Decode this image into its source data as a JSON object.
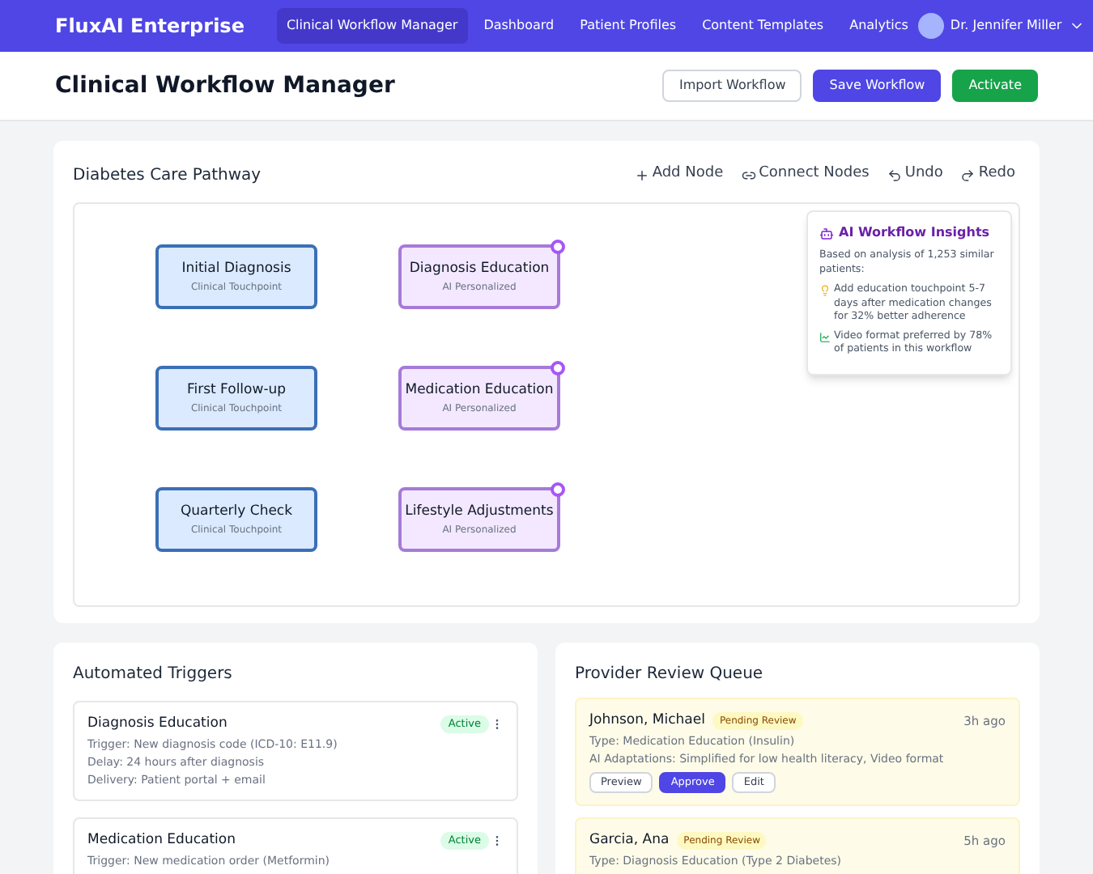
{
  "nav": {
    "brand": "FluxAI Enterprise",
    "links": [
      {
        "label": "Clinical Workflow Manager",
        "selected": true
      },
      {
        "label": "Dashboard",
        "selected": false
      },
      {
        "label": "Patient Profiles",
        "selected": false
      },
      {
        "label": "Content Templates",
        "selected": false
      },
      {
        "label": "Analytics",
        "selected": false
      }
    ],
    "user": "Dr. Jennifer Miller"
  },
  "header": {
    "title": "Clinical Workflow Manager",
    "buttons": [
      {
        "label": "Import Workflow",
        "kind": "outline"
      },
      {
        "label": "Save Workflow",
        "kind": "primary"
      },
      {
        "label": "Activate",
        "kind": "success"
      }
    ]
  },
  "pathway": {
    "title": "Diabetes Care Pathway",
    "tools": [
      {
        "label": "Add Node",
        "kind": "add"
      },
      {
        "label": "Connect Nodes",
        "kind": "link"
      },
      {
        "label": "Undo",
        "kind": "undo"
      },
      {
        "label": "Redo",
        "kind": "redo"
      }
    ],
    "nodes": [
      {
        "title": "Initial Diagnosis",
        "subtitle": "Clinical Touchpoint",
        "kind": "clinical"
      },
      {
        "title": "Diagnosis Education",
        "subtitle": "AI Personalized",
        "kind": "ai"
      },
      {
        "title": "First Follow-up",
        "subtitle": "Clinical Touchpoint",
        "kind": "clinical"
      },
      {
        "title": "Medication Education",
        "subtitle": "AI Personalized",
        "kind": "ai"
      },
      {
        "title": "Quarterly Check",
        "subtitle": "Clinical Touchpoint",
        "kind": "clinical"
      },
      {
        "title": "Lifestyle Adjustments",
        "subtitle": "AI Personalized",
        "kind": "ai"
      }
    ],
    "insights": {
      "title": "AI Workflow Insights",
      "summary": "Based on analysis of 1,253 similar patients:",
      "items": [
        {
          "text": "Add education touchpoint 5-7 days after medication changes for 32% better adherence",
          "kind": "idea"
        },
        {
          "text": "Video format preferred by 78% of patients in this workflow",
          "kind": "chart"
        }
      ]
    }
  },
  "triggers": {
    "title": "Automated Triggers",
    "items": [
      {
        "name": "Diagnosis Education",
        "status": "Active",
        "lines": [
          "Trigger: New diagnosis code (ICD-10: E11.9)",
          "Delay: 24 hours after diagnosis",
          "Delivery: Patient portal + email"
        ]
      },
      {
        "name": "Medication Education",
        "status": "Active",
        "lines": [
          "Trigger: New medication order (Metformin)"
        ]
      }
    ]
  },
  "review": {
    "title": "Provider Review Queue",
    "items": [
      {
        "patient": "Johnson, Michael",
        "status": "Pending Review",
        "time": "3h ago",
        "lines": [
          "Type: Medication Education (Insulin)",
          "AI Adaptations: Simplified for low health literacy, Video format"
        ],
        "actions": [
          {
            "label": "Preview",
            "kind": "outline"
          },
          {
            "label": "Approve",
            "kind": "primary"
          },
          {
            "label": "Edit",
            "kind": "outline"
          }
        ]
      },
      {
        "patient": "Garcia, Ana",
        "status": "Pending Review",
        "time": "5h ago",
        "lines": [
          "Type: Diagnosis Education (Type 2 Diabetes)"
        ]
      }
    ]
  }
}
